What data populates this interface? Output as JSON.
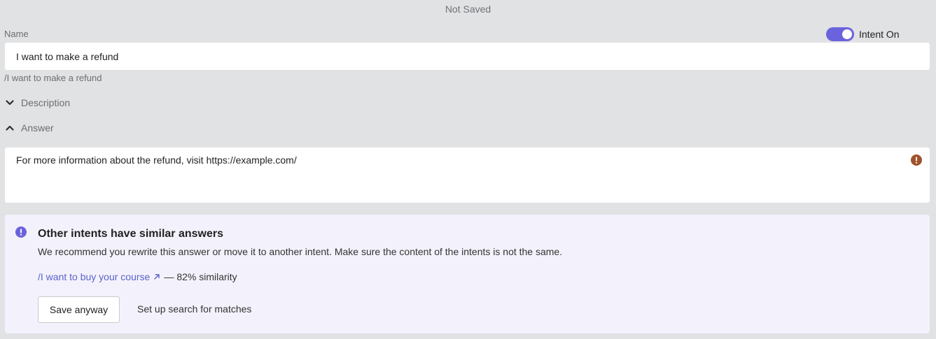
{
  "header": {
    "status": "Not Saved"
  },
  "name_field": {
    "label": "Name",
    "value": "I want to make a refund",
    "slug": "/I want to make a refund"
  },
  "intent_toggle": {
    "label": "Intent On",
    "enabled": true
  },
  "sections": {
    "description": {
      "label": "Description",
      "expanded": false
    },
    "answer": {
      "label": "Answer",
      "expanded": true
    }
  },
  "answer": {
    "text": "For more information about the refund, visit https://example.com/",
    "warning_icon": "exclamation-circle-icon"
  },
  "alert": {
    "title": "Other intents have similar answers",
    "body": "We recommend you rewrite this answer or move it to another intent. Make sure the content of the intents is not the same.",
    "match": {
      "link_text": "/I want to buy your course",
      "separator": "—",
      "similarity": "82% similarity"
    },
    "primary_button": "Save anyway",
    "secondary_button": "Set up search for matches"
  },
  "colors": {
    "accent": "#6b63dd",
    "link": "#5a62c9",
    "warning": "#a0532d",
    "background": "#e1e2e4",
    "alert_background": "#f3f2fc"
  }
}
